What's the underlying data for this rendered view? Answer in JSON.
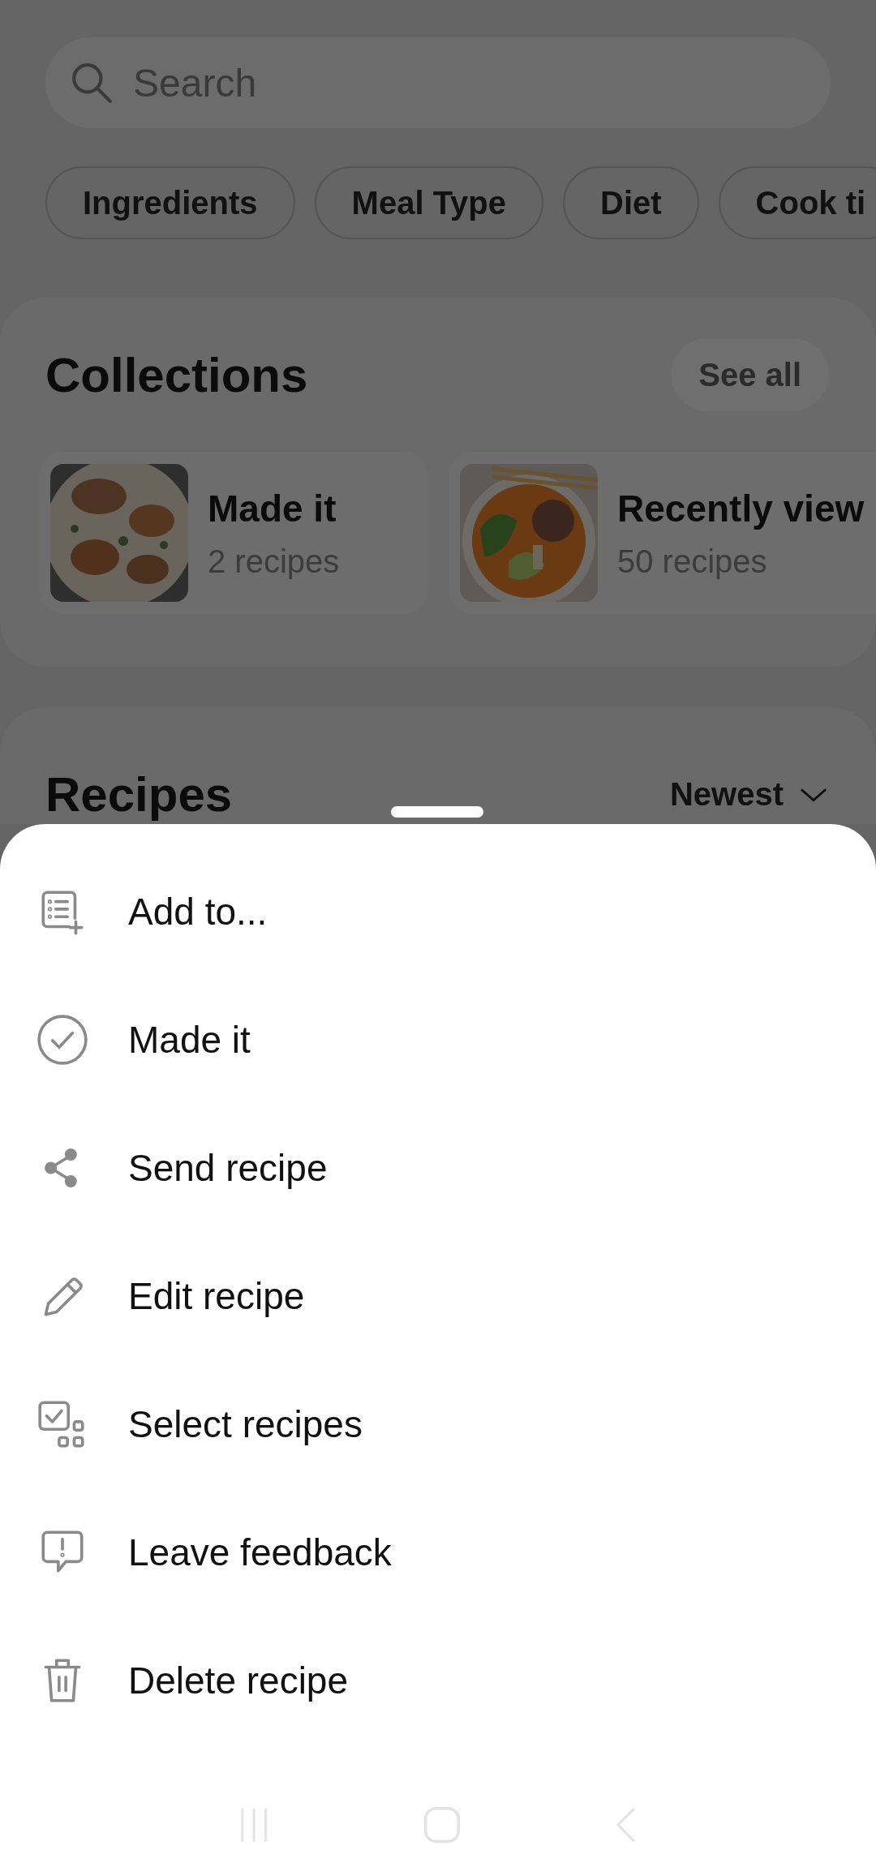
{
  "search": {
    "placeholder": "Search"
  },
  "filters": [
    {
      "label": "Ingredients"
    },
    {
      "label": "Meal Type"
    },
    {
      "label": "Diet"
    },
    {
      "label": "Cook ti"
    }
  ],
  "collections": {
    "title": "Collections",
    "see_all": "See all",
    "items": [
      {
        "name": "Made it",
        "count": "2 recipes",
        "kind": "plate"
      },
      {
        "name": "Recently view",
        "count": "50 recipes",
        "kind": "bowl"
      }
    ]
  },
  "recipes": {
    "title": "Recipes",
    "sort": "Newest"
  },
  "sheet": {
    "items": [
      {
        "label": "Add to...",
        "kind": "list-add"
      },
      {
        "label": "Made it",
        "kind": "check-circle"
      },
      {
        "label": "Send recipe",
        "kind": "share"
      },
      {
        "label": "Edit recipe",
        "kind": "pencil"
      },
      {
        "label": "Select recipes",
        "kind": "select"
      },
      {
        "label": "Leave feedback",
        "kind": "feedback"
      },
      {
        "label": "Delete recipe",
        "kind": "trash"
      }
    ]
  }
}
